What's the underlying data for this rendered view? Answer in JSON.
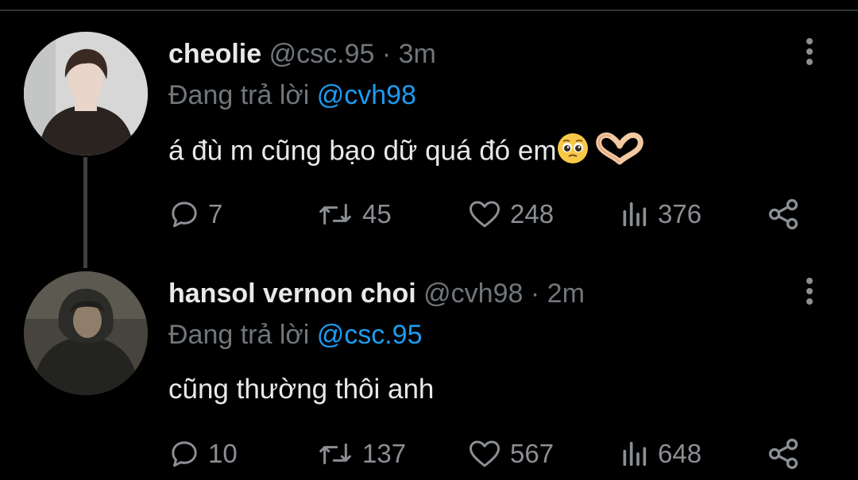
{
  "tweets": [
    {
      "name": "cheolie",
      "handle": "@csc.95",
      "separator": "·",
      "time": "3m",
      "replying_prefix": "Đang trả lời",
      "replying_to": "@cvh98",
      "text": "á đù m cũng bạo dữ quá đó em",
      "emojis": [
        "pleading-face",
        "heart-hands"
      ],
      "stats": {
        "replies": "7",
        "retweets": "45",
        "likes": "248",
        "views": "376"
      }
    },
    {
      "name": "hansol vernon choi",
      "handle": "@cvh98",
      "separator": "·",
      "time": "2m",
      "replying_prefix": "Đang trả lời",
      "replying_to": "@csc.95",
      "text": "cũng thường thôi anh",
      "emojis": [],
      "stats": {
        "replies": "10",
        "retweets": "137",
        "likes": "567",
        "views": "648"
      }
    }
  ],
  "colors": {
    "background": "#000000",
    "text": "#e7e9ea",
    "muted": "#71767b",
    "mention": "#1d9bf0",
    "icon": "#8b8f94"
  }
}
